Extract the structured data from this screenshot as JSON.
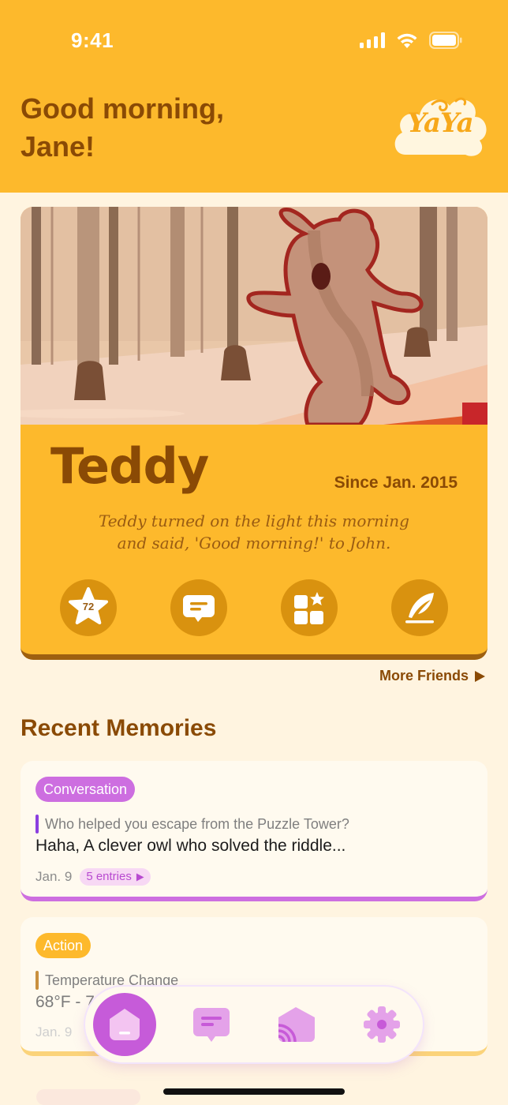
{
  "status_bar": {
    "time": "9:41"
  },
  "header": {
    "greeting_line1": "Good morning,",
    "greeting_line2": "Jane!",
    "logo_text": "YaYa"
  },
  "friend_card": {
    "name": "Teddy",
    "since": "Since Jan. 2015",
    "quote_line1": "Teddy turned on the light this morning",
    "quote_line2": "and said, 'Good morning!' to John.",
    "star_count": "72",
    "actions": [
      "stars-icon",
      "chat-icon",
      "collection-icon",
      "quill-icon"
    ]
  },
  "more_friends": "More Friends",
  "recent_memories": {
    "title": "Recent Memories",
    "items": [
      {
        "tag": "Conversation",
        "question": "Who helped you escape from the Puzzle Tower?",
        "answer": "Haha, A clever owl who solved the riddle...",
        "date": "Jan. 9",
        "entries": "5 entries"
      },
      {
        "tag": "Action",
        "question": "Temperature Change",
        "answer": "68°F - 7",
        "date": "Jan. 9"
      }
    ]
  },
  "colors": {
    "header_bg": "#fdb92c",
    "text_brown": "#8a4a05",
    "conversation_purple": "#cd6ee0",
    "page_bg": "#fff4e0"
  },
  "tabbar": {
    "tabs": [
      "home-icon",
      "chat-icon",
      "feed-icon",
      "settings-icon"
    ],
    "active": "home-icon"
  }
}
